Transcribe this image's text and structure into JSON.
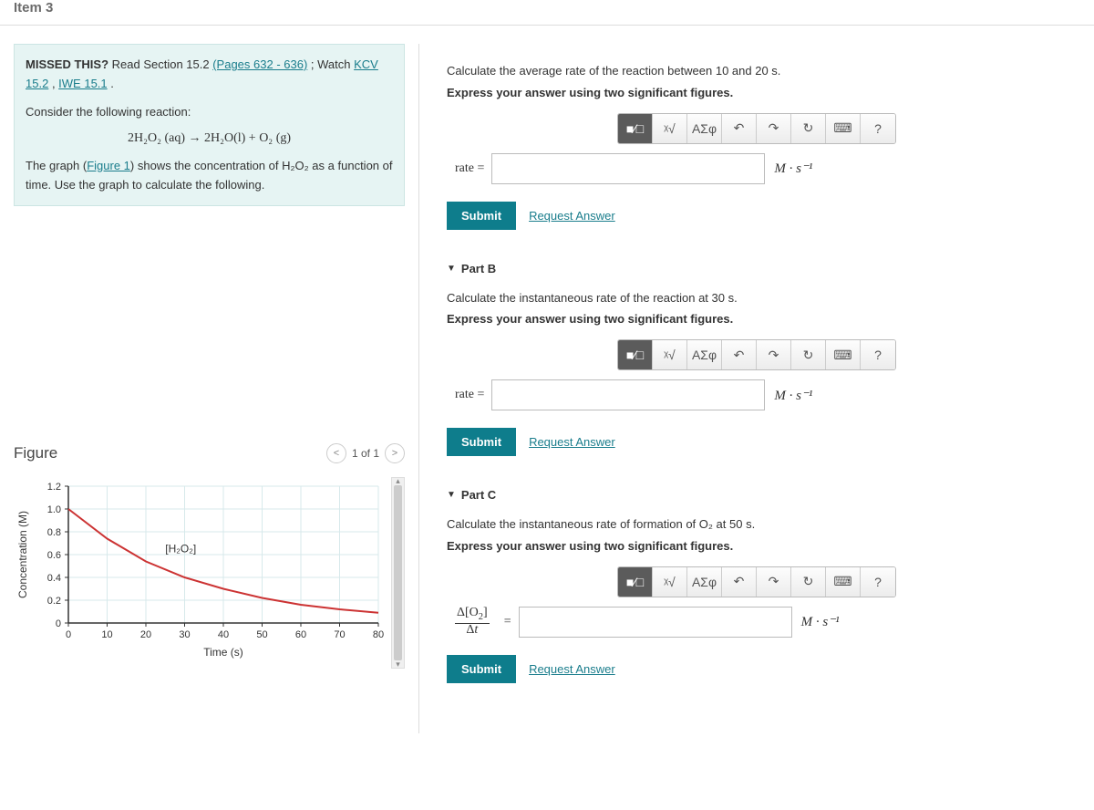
{
  "item_title": "Item 3",
  "missed": {
    "lead": "MISSED THIS?",
    "text1": " Read Section 15.2 ",
    "link1": "(Pages 632 - 636)",
    "text2": " ; Watch ",
    "link2": "KCV 15.2",
    "text3": ", ",
    "link3": "IWE 15.1",
    "text4": " .",
    "consider": "Consider the following reaction:",
    "equation": "2H₂O₂ (aq) → 2H₂O(l) + O₂ (g)",
    "graph_text1": "The graph (",
    "graph_link": "Figure 1",
    "graph_text2": ") shows the concentration of H₂O₂ as a function of time. Use the graph to calculate the following."
  },
  "figure": {
    "title": "Figure",
    "pager": "1 of 1"
  },
  "chart_data": {
    "type": "line",
    "title": "",
    "xlabel": "Time (s)",
    "ylabel": "Concentration (M)",
    "series_label": "[H₂O₂]",
    "xlim": [
      0,
      80
    ],
    "ylim": [
      0,
      1.2
    ],
    "x_ticks": [
      0,
      10,
      20,
      30,
      40,
      50,
      60,
      70,
      80
    ],
    "y_ticks": [
      0,
      0.2,
      0.4,
      0.6,
      0.8,
      1.0,
      1.2
    ],
    "series": [
      {
        "name": "[H2O2]",
        "x": [
          0,
          10,
          20,
          30,
          40,
          50,
          60,
          70,
          80
        ],
        "y": [
          1.0,
          0.74,
          0.54,
          0.4,
          0.3,
          0.22,
          0.16,
          0.12,
          0.09
        ]
      }
    ]
  },
  "parts": {
    "a": {
      "prompt": "Calculate the average rate of the reaction between 10 and 20 s.",
      "instruct": "Express your answer using two significant figures.",
      "label": "rate =",
      "units": "M · s⁻¹"
    },
    "b": {
      "header": "Part B",
      "prompt": "Calculate the instantaneous rate of the reaction at 30 s.",
      "instruct": "Express your answer using two significant figures.",
      "label": "rate =",
      "units": "M · s⁻¹"
    },
    "c": {
      "header": "Part C",
      "prompt": "Calculate the instantaneous rate of formation of O₂ at 50 s.",
      "instruct": "Express your answer using two significant figures.",
      "label_html": "Δ[O₂] / Δt =",
      "units": "M · s⁻¹"
    }
  },
  "toolbar": {
    "templates_icon": "■⁄□",
    "math_icon": "ᵡ√",
    "greek": "ΑΣφ",
    "undo": "↶",
    "redo": "↷",
    "reset": "↻",
    "keyboard": "⌨",
    "help": "?"
  },
  "buttons": {
    "submit": "Submit",
    "request": "Request Answer"
  }
}
